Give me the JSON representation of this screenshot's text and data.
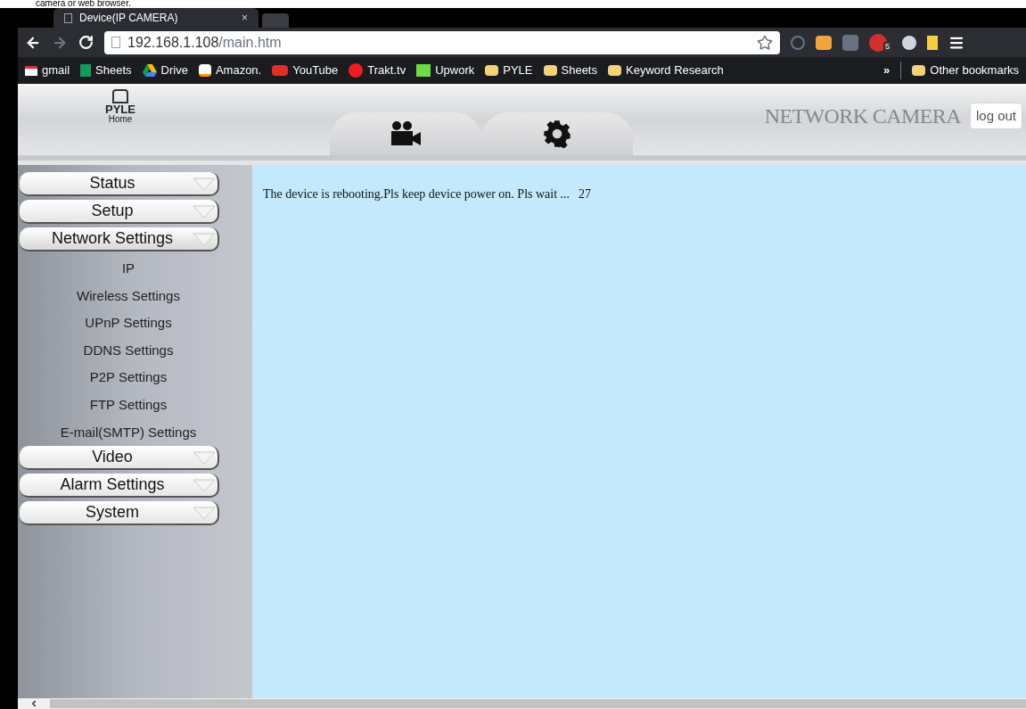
{
  "caption": "camera or web browser.",
  "browser": {
    "tab_title": "Device(IP CAMERA)",
    "close_glyph": "×",
    "url_host": "192.168.1.108",
    "url_path": "/main.htm",
    "extension_badge": "5",
    "bookmarks": [
      {
        "label": "gmail",
        "kind": "gmail"
      },
      {
        "label": "Sheets",
        "kind": "sheets"
      },
      {
        "label": "Drive",
        "kind": "drive"
      },
      {
        "label": "Amazon.",
        "kind": "amazon"
      },
      {
        "label": "YouTube",
        "kind": "youtube"
      },
      {
        "label": "Trakt.tv",
        "kind": "trakt"
      },
      {
        "label": "Upwork",
        "kind": "upwork"
      },
      {
        "label": "PYLE",
        "kind": "folder"
      },
      {
        "label": "Sheets",
        "kind": "folder"
      },
      {
        "label": "Keyword Research",
        "kind": "folder"
      }
    ],
    "overflow": "»",
    "other_bookmarks": "Other bookmarks"
  },
  "header": {
    "logo_text": "PYLE",
    "logo_subtext": "Home",
    "title": "NETWORK CAMERA",
    "logout": "log out"
  },
  "sidebar": {
    "items": [
      {
        "label": "Status",
        "expanded": false
      },
      {
        "label": "Setup",
        "expanded": false
      },
      {
        "label": "Network Settings",
        "expanded": true,
        "children": [
          {
            "label": "IP"
          },
          {
            "label": "Wireless Settings"
          },
          {
            "label": "UPnP Settings"
          },
          {
            "label": "DDNS Settings"
          },
          {
            "label": "P2P Settings"
          },
          {
            "label": "FTP Settings"
          },
          {
            "label": "E-mail(SMTP) Settings"
          }
        ]
      },
      {
        "label": "Video",
        "expanded": false
      },
      {
        "label": "Alarm Settings",
        "expanded": false
      },
      {
        "label": "System",
        "expanded": false
      }
    ]
  },
  "content": {
    "message": "The device is rebooting.Pls keep device power on. Pls wait ...",
    "countdown": "27"
  }
}
